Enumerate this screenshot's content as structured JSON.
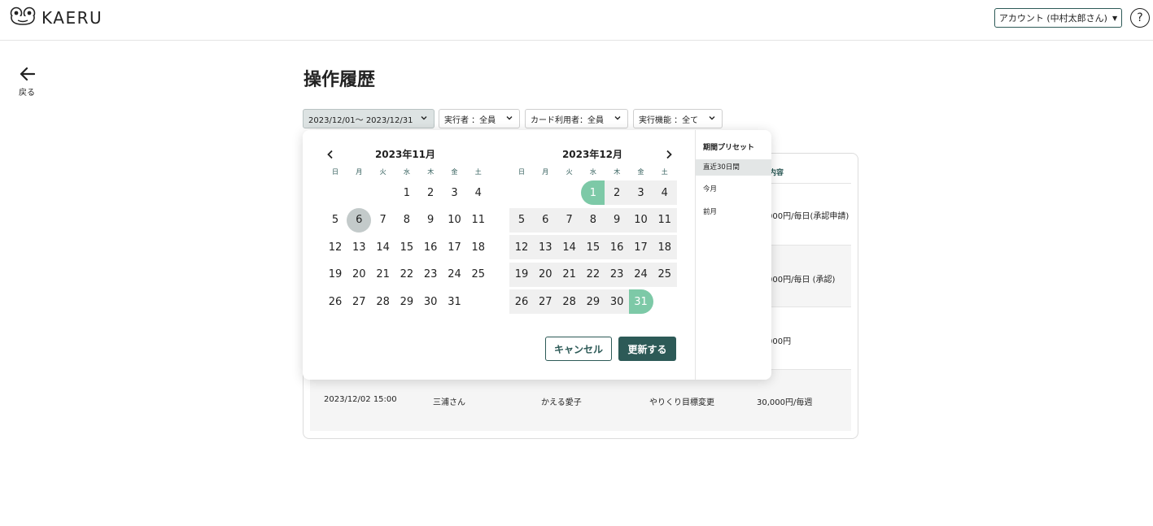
{
  "header": {
    "logo_text": "KAERU",
    "account_label": "アカウント (中村太郎さん)",
    "help_label": "?"
  },
  "back": {
    "label": "戻る"
  },
  "page_title": "操作履歴",
  "filters": {
    "date_range": "2023/12/01〜 2023/12/31",
    "executor": "実行者 ：全員",
    "card_user": "カード利用者：全員",
    "function": "実行機能 ：全て"
  },
  "table": {
    "header_content": "内容",
    "rows": [
      {
        "col5": "000円/毎日(承認申請)"
      },
      {
        "col5": "000円/毎日 (承認)"
      },
      {
        "col5": "000円"
      },
      {
        "datetime": "2023/12/02 15:00",
        "executor": "三浦さん",
        "card_user": "かえる愛子",
        "function": "やりくり目標変更",
        "content": "30,000円/毎週"
      }
    ]
  },
  "picker": {
    "weekdays": [
      "日",
      "月",
      "火",
      "水",
      "木",
      "金",
      "土"
    ],
    "left_month": {
      "title": "2023年11月",
      "rows": [
        [
          "",
          "",
          "",
          "1",
          "2",
          "3",
          "4"
        ],
        [
          "5",
          "6",
          "7",
          "8",
          "9",
          "10",
          "11"
        ],
        [
          "12",
          "13",
          "14",
          "15",
          "16",
          "17",
          "18"
        ],
        [
          "19",
          "20",
          "21",
          "22",
          "23",
          "24",
          "25"
        ],
        [
          "26",
          "27",
          "28",
          "29",
          "30",
          "31",
          ""
        ]
      ]
    },
    "right_month": {
      "title": "2023年12月",
      "rows": [
        [
          "",
          "",
          "",
          "1",
          "2",
          "3",
          "4"
        ],
        [
          "5",
          "6",
          "7",
          "8",
          "9",
          "10",
          "11"
        ],
        [
          "12",
          "13",
          "14",
          "15",
          "16",
          "17",
          "18"
        ],
        [
          "19",
          "20",
          "21",
          "22",
          "23",
          "24",
          "25"
        ],
        [
          "26",
          "27",
          "28",
          "29",
          "30",
          "31",
          ""
        ]
      ]
    },
    "cancel_label": "キャンセル",
    "update_label": "更新する",
    "presets": {
      "title": "期間プリセット",
      "items": [
        "直近30日間",
        "今月",
        "前月"
      ],
      "selected": "直近30日間"
    }
  },
  "colors": {
    "accent": "#2d5a57",
    "range_edge": "#7dc9a7",
    "range_fill": "#f0f0f0",
    "today": "#c3caca"
  }
}
